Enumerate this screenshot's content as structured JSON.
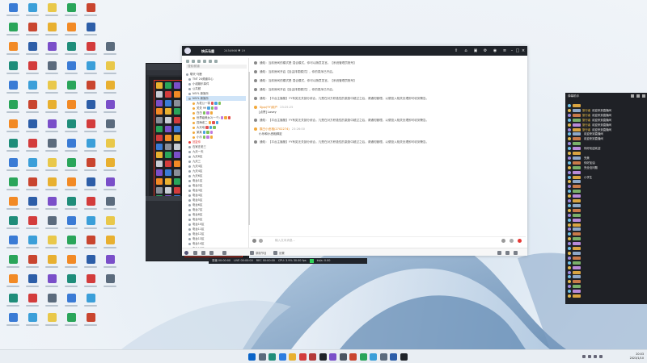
{
  "main_window": {
    "title": "快乐马鹿",
    "ids": "2454966  ♥ 19",
    "search_placeholder": "搜索/频道",
    "input_placeholder": "输入文本消息...",
    "bottom": {
      "mic_label": "",
      "record_label": "录制节目",
      "stream_label": "设置"
    },
    "status_line": {
      "items": [
        "录播 00:00:00",
        "LIVE 00:00:00",
        "REC 00:00:00",
        "CPU: 3.9% 30.00 fps",
        "kb/s: 0.00"
      ]
    }
  },
  "tree": {
    "rows": [
      {
        "label": "聊天·马鹿",
        "kind": "root",
        "selected": false
      },
      {
        "label": "TNT 24频道中心",
        "kind": "folder",
        "selected": false
      },
      {
        "label": "小组娱乐事件",
        "kind": "folder",
        "selected": false
      },
      {
        "label": "公共频",
        "kind": "folder",
        "selected": false
      },
      {
        "label": "NSYL 新娱乐",
        "kind": "folder",
        "selected": false
      },
      {
        "label": "NSYL 新娱乐",
        "kind": "folder",
        "selected": true
      },
      {
        "label": "大老公一零",
        "kind": "user",
        "selected": false
      },
      {
        "label": "关关 99",
        "kind": "user",
        "selected": false
      },
      {
        "label": "白白",
        "kind": "user",
        "selected": false
      },
      {
        "label": "世界级美女2(一个)",
        "kind": "user",
        "selected": false
      },
      {
        "label": "四海老二",
        "kind": "user",
        "selected": false
      },
      {
        "label": "大天地",
        "kind": "user",
        "selected": false
      },
      {
        "label": "某某",
        "kind": "user",
        "selected": false
      },
      {
        "label": "小乐",
        "kind": "user",
        "selected": false
      },
      {
        "label": "回复你",
        "kind": "folder-red",
        "selected": false
      },
      {
        "label": "石家庄老三",
        "kind": "folder",
        "selected": false
      },
      {
        "label": "九天一天",
        "kind": "folder",
        "selected": false
      },
      {
        "label": "九天8区",
        "kind": "folder",
        "selected": false
      },
      {
        "label": "九天三",
        "kind": "folder",
        "selected": false
      },
      {
        "label": "九天4区",
        "kind": "folder",
        "selected": false
      },
      {
        "label": "九天4区",
        "kind": "folder",
        "selected": false
      },
      {
        "label": "九天6区",
        "kind": "folder",
        "selected": false
      },
      {
        "label": "电台1区",
        "kind": "folder",
        "selected": false
      },
      {
        "label": "电台2区",
        "kind": "folder",
        "selected": false
      },
      {
        "label": "电台3区",
        "kind": "folder",
        "selected": false
      },
      {
        "label": "电台4区",
        "kind": "folder",
        "selected": false
      },
      {
        "label": "电台5区",
        "kind": "folder",
        "selected": false
      },
      {
        "label": "电台6区",
        "kind": "folder",
        "selected": false
      },
      {
        "label": "电台7区",
        "kind": "folder",
        "selected": false
      },
      {
        "label": "电台8区",
        "kind": "folder",
        "selected": false
      },
      {
        "label": "电台9区",
        "kind": "folder",
        "selected": false
      },
      {
        "label": "电台10区",
        "kind": "folder",
        "selected": false
      },
      {
        "label": "电台11区",
        "kind": "folder",
        "selected": false
      },
      {
        "label": "电台12区",
        "kind": "folder",
        "selected": false
      },
      {
        "label": "电台13区",
        "kind": "folder",
        "selected": false
      },
      {
        "label": "电台14区",
        "kind": "folder",
        "selected": false
      },
      {
        "label": "电台15区",
        "kind": "folder",
        "selected": false
      }
    ]
  },
  "messages": [
    {
      "text": "通知：当前房间的模式是 混合模式，你可以随意发言。【系统管理员账号】",
      "kind": "notice"
    },
    {
      "text": "通知：当前房间开启【自由排麦模式】，你的麦序已开启。",
      "kind": "notice"
    },
    {
      "text": "通知：当前房间的模式是 混合模式，你可以随意发言。【系统管理员账号】",
      "kind": "notice"
    },
    {
      "text": "通知：当前房间开启【自由排麦模式】，你的麦序已开启。",
      "kind": "notice"
    },
    {
      "text": "通知：【平台主播管】YY有奖无关部分综合，凡是在对方积极性的激励中超过之后，请通知管理。以便投入相关处理即可收到警告。",
      "kind": "notice"
    },
    {
      "from": "Sjpp(YY)用户",
      "time": "23:25:25",
      "text": "[点赞] Lovey",
      "kind": "chat"
    },
    {
      "text": "通知：【平台主播管】YY有奖无关部分综合，凡是在对方积极性的激励中超过之后，请通知管理。以便投入相关处理即可收到警告。",
      "kind": "notice"
    },
    {
      "from": "霸王小丞相(2702274)",
      "time": "23:26:00",
      "text": "小乐和小丞相绑定",
      "kind": "chat"
    },
    {
      "text": "通知：【平台主播管】YY有奖无关部分综合，凡是在对方积极性的激励中超过之后，请通知管理。以便投入相关处理即可收到警告。",
      "kind": "notice"
    }
  ],
  "danmu": {
    "title": "弹幕助手",
    "rows": [
      {
        "badge": "",
        "name": "",
        "text": "",
        "red": ""
      },
      {
        "badge": "",
        "name": "旅行者",
        "text": "欢迎来到直播间",
        "red": ""
      },
      {
        "badge": "",
        "name": "旅行者",
        "text": "欢迎来到直播间",
        "red": ""
      },
      {
        "badge": "",
        "name": "旅行者",
        "text": "欢迎来到直播间",
        "red": ""
      },
      {
        "badge": "",
        "name": "旅行者",
        "text": "欢迎来到直播间",
        "red": ""
      },
      {
        "badge": "",
        "name": "旅行者",
        "text": "欢迎来到直播间",
        "red": ""
      },
      {
        "badge": "",
        "name": "",
        "text": "欢迎来到直播间",
        "red": ""
      },
      {
        "badge": "",
        "name": "",
        "text": "欢迎来到直播间",
        "red": ""
      },
      {
        "badge": "",
        "name": "",
        "text": "",
        "red": ""
      },
      {
        "badge": "",
        "name": "",
        "text": "你好欢迎欢迎",
        "red": ""
      },
      {
        "badge": "",
        "name": "",
        "text": "",
        "red": "1"
      },
      {
        "badge": "",
        "name": "",
        "text": "完美",
        "red": ""
      },
      {
        "badge": "",
        "name": "",
        "text": "你好加油",
        "red": ""
      },
      {
        "badge": "",
        "name": "",
        "text": "完全没问题",
        "red": ""
      },
      {
        "badge": "",
        "name": "",
        "text": "",
        "red": ""
      },
      {
        "badge": "",
        "name": "",
        "text": "小学生",
        "red": ""
      },
      {
        "badge": "",
        "name": "",
        "text": "",
        "red": ""
      },
      {
        "badge": "",
        "name": "",
        "text": "",
        "red": ""
      },
      {
        "badge": "",
        "name": "",
        "text": "",
        "red": ""
      },
      {
        "badge": "",
        "name": "",
        "text": "",
        "red": ""
      },
      {
        "badge": "",
        "name": "",
        "text": "",
        "red": ""
      },
      {
        "badge": "",
        "name": "",
        "text": "",
        "red": ""
      },
      {
        "badge": "",
        "name": "",
        "text": "",
        "red": ""
      },
      {
        "badge": "",
        "name": "",
        "text": "",
        "red": ""
      },
      {
        "badge": "",
        "name": "",
        "text": "",
        "red": ""
      },
      {
        "badge": "",
        "name": "",
        "text": "",
        "red": ""
      },
      {
        "badge": "",
        "name": "",
        "text": "",
        "red": ""
      },
      {
        "badge": "",
        "name": "",
        "text": "",
        "red": ""
      },
      {
        "badge": "",
        "name": "",
        "text": "",
        "red": ""
      },
      {
        "badge": "",
        "name": "",
        "text": "",
        "red": ""
      },
      {
        "badge": "",
        "name": "",
        "text": "",
        "red": ""
      },
      {
        "badge": "",
        "name": "",
        "text": "",
        "red": ""
      },
      {
        "badge": "",
        "name": "",
        "text": "",
        "red": ""
      },
      {
        "badge": "",
        "name": "",
        "text": "",
        "red": ""
      },
      {
        "badge": "",
        "name": "",
        "text": "",
        "red": ""
      },
      {
        "badge": "",
        "name": "",
        "text": "",
        "red": ""
      },
      {
        "badge": "",
        "name": "",
        "text": "",
        "red": ""
      },
      {
        "badge": "",
        "name": "",
        "text": "",
        "red": ""
      },
      {
        "badge": "",
        "name": "",
        "text": "",
        "red": ""
      },
      {
        "badge": "",
        "name": "",
        "text": "",
        "red": ""
      },
      {
        "badge": "",
        "name": "",
        "text": "",
        "red": ""
      },
      {
        "badge": "",
        "name": "",
        "text": "",
        "red": ""
      }
    ]
  },
  "obs": {
    "scene_label": "",
    "source_label": ""
  },
  "taskbar": {
    "time": "20:03",
    "date": "2023/1/10"
  },
  "colors": {
    "titlebar": "#1f2329",
    "danmu_bg": "#1f2126",
    "accent_red": "#e53935",
    "accent_orange": "#f6c64a"
  }
}
